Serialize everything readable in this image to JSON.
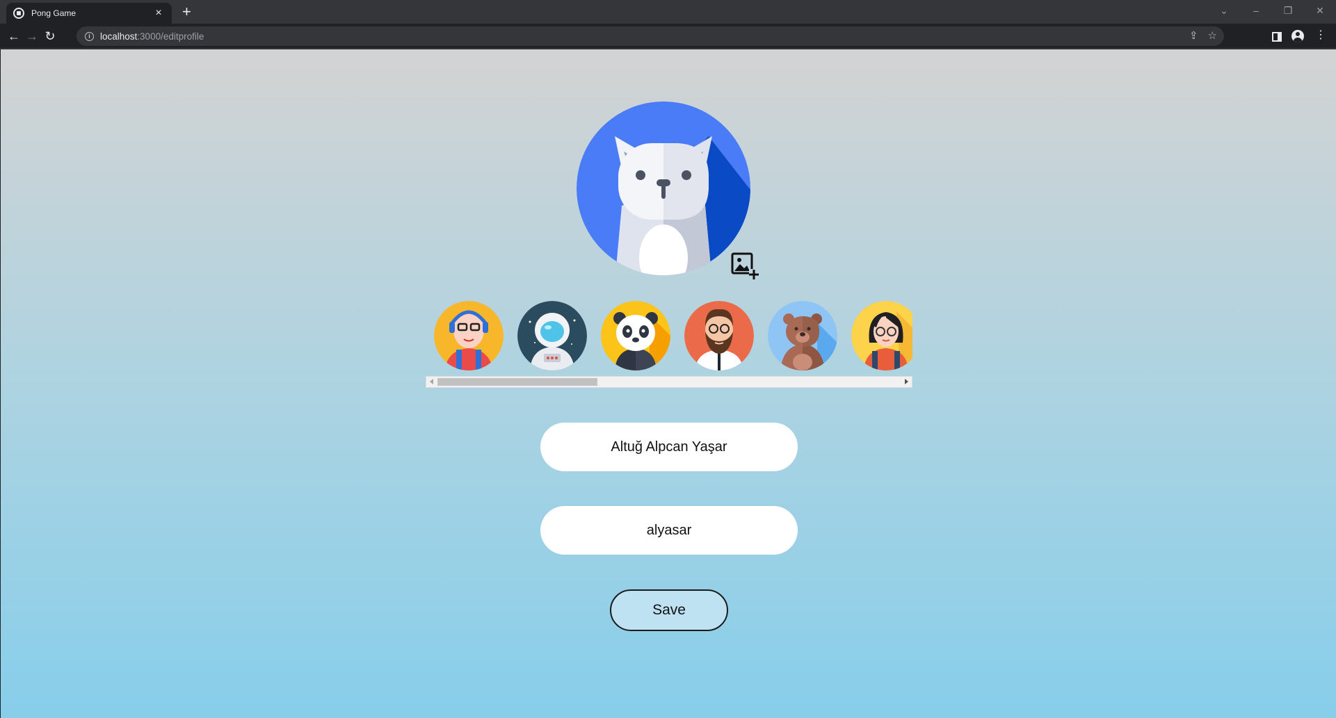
{
  "browser": {
    "tab_title": "Pong Game",
    "url_host": "localhost",
    "url_path": ":3000/editprofile",
    "new_tab_symbol": "+",
    "close_tab_symbol": "×"
  },
  "profile": {
    "main_avatar": "white-cat-avatar",
    "main_avatar_colors": {
      "background": "#4a7cf7",
      "shadow": "#0a4ac4"
    },
    "upload_icon": "image-add-icon",
    "avatar_options": [
      {
        "name": "avatar-option-headphones-boy",
        "bg": "#f8b62a"
      },
      {
        "name": "avatar-option-astronaut",
        "bg": "#2b4b5e"
      },
      {
        "name": "avatar-option-panda",
        "bg": "#fcc419"
      },
      {
        "name": "avatar-option-bearded-man",
        "bg": "#ea6a4a"
      },
      {
        "name": "avatar-option-bear",
        "bg": "#8ec5f5"
      },
      {
        "name": "avatar-option-glasses-girl",
        "bg": "#fcd34a"
      }
    ]
  },
  "form": {
    "full_name_value": "Altuğ Alpcan Yaşar",
    "username_value": "alyasar",
    "save_label": "Save"
  },
  "colors": {
    "gradient_top": "#d3d3d3",
    "gradient_bottom": "#87ceeb",
    "save_bg": "#bfe2f3"
  }
}
